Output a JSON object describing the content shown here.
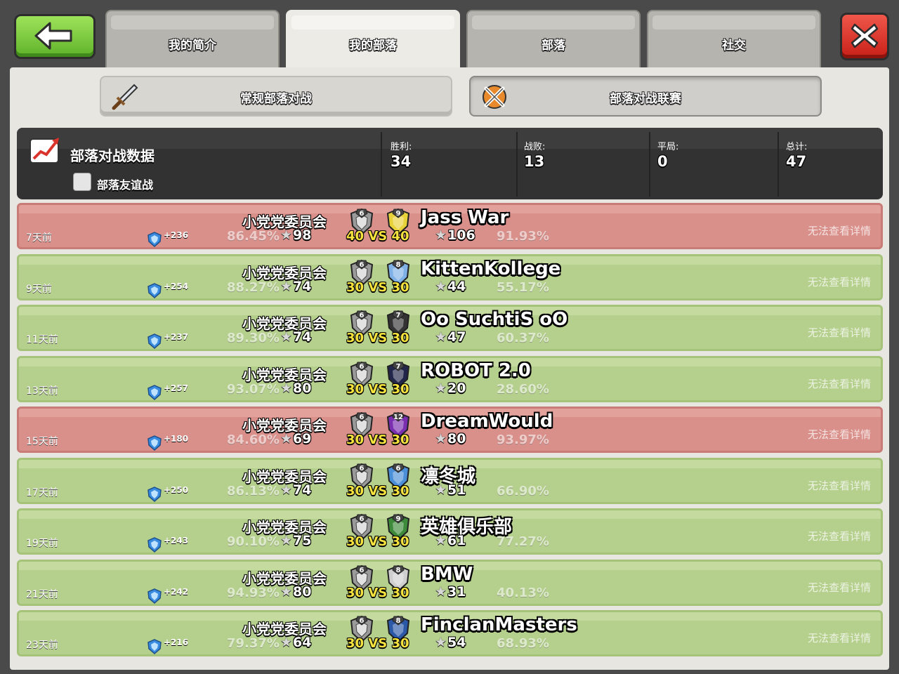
{
  "tabs": [
    "我的简介",
    "我的部落",
    "部落",
    "社交"
  ],
  "active_tab": 1,
  "subtabs": [
    "常规部落对战",
    "部落对战联赛"
  ],
  "stats": {
    "title": "部落对战数据",
    "friendly_label": "部落友谊战",
    "wins_label": "胜利:",
    "wins": "34",
    "losses_label": "战败:",
    "losses": "13",
    "draws_label": "平局:",
    "draws": "0",
    "total_label": "总计:",
    "total": "47"
  },
  "colors": {
    "win_row": "#b5cf8c",
    "loss_row": "#d98f8a",
    "size_text": "#f7e33d"
  },
  "wars": [
    {
      "result": "loss",
      "ago": "7天前",
      "trophies": "+236",
      "my_clan": "小党党委员会",
      "my_pct": "86.45%",
      "my_stars": "98",
      "my_level": "6",
      "size": "40 VS 40",
      "opp_level": "9",
      "opp_badge_color": "#e8d23a",
      "opp_name": "Jass War",
      "opp_stars": "106",
      "opp_pct": "91.93%",
      "detail": "无法查看详情"
    },
    {
      "result": "win",
      "ago": "9天前",
      "trophies": "+254",
      "my_clan": "小党党委员会",
      "my_pct": "88.27%",
      "my_stars": "74",
      "my_level": "6",
      "size": "30 VS 30",
      "opp_level": "8",
      "opp_badge_color": "#7fb0e6",
      "opp_name": "KittenKollege",
      "opp_stars": "44",
      "opp_pct": "55.17%",
      "detail": "无法查看详情"
    },
    {
      "result": "win",
      "ago": "11天前",
      "trophies": "+237",
      "my_clan": "小党党委员会",
      "my_pct": "89.30%",
      "my_stars": "74",
      "my_level": "6",
      "size": "30 VS 30",
      "opp_level": "7",
      "opp_badge_color": "#333333",
      "opp_name": "Oo SuchtiS oO",
      "opp_stars": "47",
      "opp_pct": "60.37%",
      "detail": "无法查看详情"
    },
    {
      "result": "win",
      "ago": "13天前",
      "trophies": "+257",
      "my_clan": "小党党委员会",
      "my_pct": "93.07%",
      "my_stars": "80",
      "my_level": "6",
      "size": "30 VS 30",
      "opp_level": "7",
      "opp_badge_color": "#22264a",
      "opp_name": "ROBOT 2.0",
      "opp_stars": "20",
      "opp_pct": "28.60%",
      "detail": "无法查看详情"
    },
    {
      "result": "loss",
      "ago": "15天前",
      "trophies": "+180",
      "my_clan": "小党党委员会",
      "my_pct": "84.60%",
      "my_stars": "69",
      "my_level": "6",
      "size": "30 VS 30",
      "opp_level": "12",
      "opp_badge_color": "#7a2fb0",
      "opp_name": "DreamWould",
      "opp_stars": "80",
      "opp_pct": "93.97%",
      "detail": "无法查看详情"
    },
    {
      "result": "win",
      "ago": "17天前",
      "trophies": "+250",
      "my_clan": "小党党委员会",
      "my_pct": "86.13%",
      "my_stars": "74",
      "my_level": "6",
      "size": "30 VS 30",
      "opp_level": "6",
      "opp_badge_color": "#4a8fd8",
      "opp_name": "凛冬城",
      "opp_stars": "51",
      "opp_pct": "66.90%",
      "detail": "无法查看详情"
    },
    {
      "result": "win",
      "ago": "19天前",
      "trophies": "+243",
      "my_clan": "小党党委员会",
      "my_pct": "90.10%",
      "my_stars": "75",
      "my_level": "6",
      "size": "30 VS 30",
      "opp_level": "9",
      "opp_badge_color": "#3c8a3a",
      "opp_name": "英雄俱乐部",
      "opp_stars": "61",
      "opp_pct": "77.27%",
      "detail": "无法查看详情"
    },
    {
      "result": "win",
      "ago": "21天前",
      "trophies": "+242",
      "my_clan": "小党党委员会",
      "my_pct": "94.93%",
      "my_stars": "80",
      "my_level": "6",
      "size": "30 VS 30",
      "opp_level": "8",
      "opp_badge_color": "#cfcfcf",
      "opp_name": "BMW",
      "opp_stars": "31",
      "opp_pct": "40.13%",
      "detail": "无法查看详情"
    },
    {
      "result": "win",
      "ago": "23天前",
      "trophies": "+216",
      "my_clan": "小党党委员会",
      "my_pct": "79.37%",
      "my_stars": "64",
      "my_level": "6",
      "size": "30 VS 30",
      "opp_level": "8",
      "opp_badge_color": "#2c58a8",
      "opp_name": "FinclanMasters",
      "opp_stars": "54",
      "opp_pct": "68.93%",
      "detail": "无法查看详情"
    }
  ]
}
